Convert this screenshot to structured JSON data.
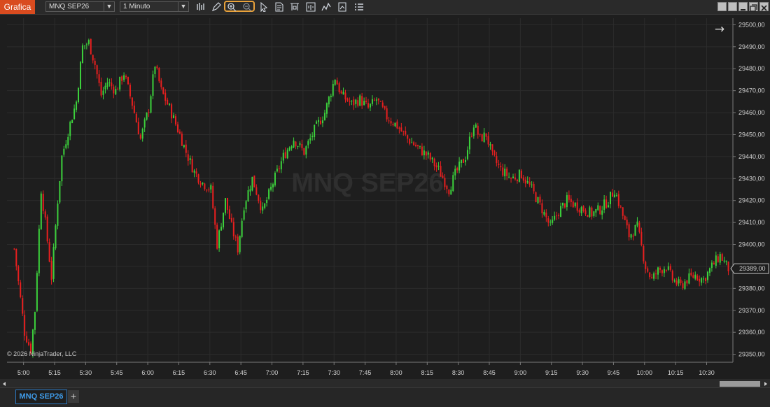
{
  "toolbar": {
    "app_title": "Grafica",
    "instrument": "MNQ SEP26",
    "instrument_caret": "▼",
    "timeframe": "1 Minuto",
    "timeframe_caret": "▼"
  },
  "chart": {
    "watermark": "MNQ SEP26",
    "copyright": "© 2026 NinjaTrader, LLC",
    "last_price_label": "29389,00",
    "nav_arrow": "→",
    "colors": {
      "up": "#3cd13c",
      "down": "#e81f1f",
      "background": "#1e1e1e",
      "grid": "#2c2c2c"
    }
  },
  "chart_data": {
    "type": "candlestick",
    "instrument": "MNQ SEP26",
    "interval": "1 Minuto",
    "y_tick_labels": [
      "29500,00",
      "29490,00",
      "29480,00",
      "29470,00",
      "29460,00",
      "29450,00",
      "29440,00",
      "29430,00",
      "29420,00",
      "29410,00",
      "29400,00",
      "29390,00",
      "29380,00",
      "29370,00",
      "29360,00",
      "29350,00"
    ],
    "x_tick_labels": [
      "5:00",
      "5:15",
      "5:30",
      "5:45",
      "6:00",
      "6:15",
      "6:30",
      "6:45",
      "7:00",
      "7:15",
      "7:30",
      "7:45",
      "8:00",
      "8:15",
      "8:30",
      "8:45",
      "9:00",
      "9:15",
      "9:30",
      "9:45",
      "10:00",
      "10:15",
      "10:30"
    ],
    "ylim": [
      29347,
      29503
    ],
    "last_price": 29389,
    "close_path": [
      [
        "4:55",
        29398
      ],
      [
        "5:00",
        29360
      ],
      [
        "5:03",
        29352
      ],
      [
        "5:05",
        29370
      ],
      [
        "5:08",
        29425
      ],
      [
        "5:10",
        29410
      ],
      [
        "5:13",
        29385
      ],
      [
        "5:16",
        29420
      ],
      [
        "5:18",
        29440
      ],
      [
        "5:22",
        29455
      ],
      [
        "5:25",
        29465
      ],
      [
        "5:28",
        29490
      ],
      [
        "5:31",
        29492
      ],
      [
        "5:34",
        29482
      ],
      [
        "5:37",
        29468
      ],
      [
        "5:40",
        29474
      ],
      [
        "5:44",
        29470
      ],
      [
        "5:48",
        29478
      ],
      [
        "5:52",
        29464
      ],
      [
        "5:56",
        29448
      ],
      [
        "6:00",
        29462
      ],
      [
        "6:03",
        29482
      ],
      [
        "6:06",
        29470
      ],
      [
        "6:10",
        29462
      ],
      [
        "6:15",
        29450
      ],
      [
        "6:18",
        29442
      ],
      [
        "6:22",
        29433
      ],
      [
        "6:26",
        29428
      ],
      [
        "6:30",
        29425
      ],
      [
        "6:33",
        29400
      ],
      [
        "6:37",
        29420
      ],
      [
        "6:40",
        29408
      ],
      [
        "6:43",
        29398
      ],
      [
        "6:46",
        29418
      ],
      [
        "6:50",
        29430
      ],
      [
        "6:55",
        29415
      ],
      [
        "7:00",
        29428
      ],
      [
        "7:05",
        29440
      ],
      [
        "7:10",
        29448
      ],
      [
        "7:15",
        29442
      ],
      [
        "7:20",
        29452
      ],
      [
        "7:25",
        29460
      ],
      [
        "7:30",
        29476
      ],
      [
        "7:33",
        29468
      ],
      [
        "7:38",
        29464
      ],
      [
        "7:42",
        29466
      ],
      [
        "7:46",
        29462
      ],
      [
        "7:50",
        29466
      ],
      [
        "7:55",
        29458
      ],
      [
        "8:00",
        29454
      ],
      [
        "8:05",
        29448
      ],
      [
        "8:10",
        29444
      ],
      [
        "8:15",
        29440
      ],
      [
        "8:20",
        29434
      ],
      [
        "8:25",
        29425
      ],
      [
        "8:28",
        29432
      ],
      [
        "8:33",
        29440
      ],
      [
        "8:37",
        29455
      ],
      [
        "8:40",
        29448
      ],
      [
        "8:43",
        29450
      ],
      [
        "8:46",
        29440
      ],
      [
        "8:50",
        29434
      ],
      [
        "8:55",
        29430
      ],
      [
        "9:00",
        29432
      ],
      [
        "9:05",
        29425
      ],
      [
        "9:10",
        29416
      ],
      [
        "9:14",
        29408
      ],
      [
        "9:18",
        29415
      ],
      [
        "9:22",
        29420
      ],
      [
        "9:26",
        29418
      ],
      [
        "9:30",
        29416
      ],
      [
        "9:34",
        29414
      ],
      [
        "9:38",
        29416
      ],
      [
        "9:42",
        29420
      ],
      [
        "9:45",
        29425
      ],
      [
        "9:48",
        29416
      ],
      [
        "9:52",
        29404
      ],
      [
        "9:56",
        29408
      ],
      [
        "10:00",
        29390
      ],
      [
        "10:03",
        29384
      ],
      [
        "10:06",
        29388
      ],
      [
        "10:10",
        29390
      ],
      [
        "10:13",
        29384
      ],
      [
        "10:17",
        29381
      ],
      [
        "10:20",
        29384
      ],
      [
        "10:24",
        29386
      ],
      [
        "10:28",
        29384
      ],
      [
        "10:32",
        29390
      ],
      [
        "10:36",
        29395
      ],
      [
        "10:40",
        29389
      ]
    ]
  }
}
